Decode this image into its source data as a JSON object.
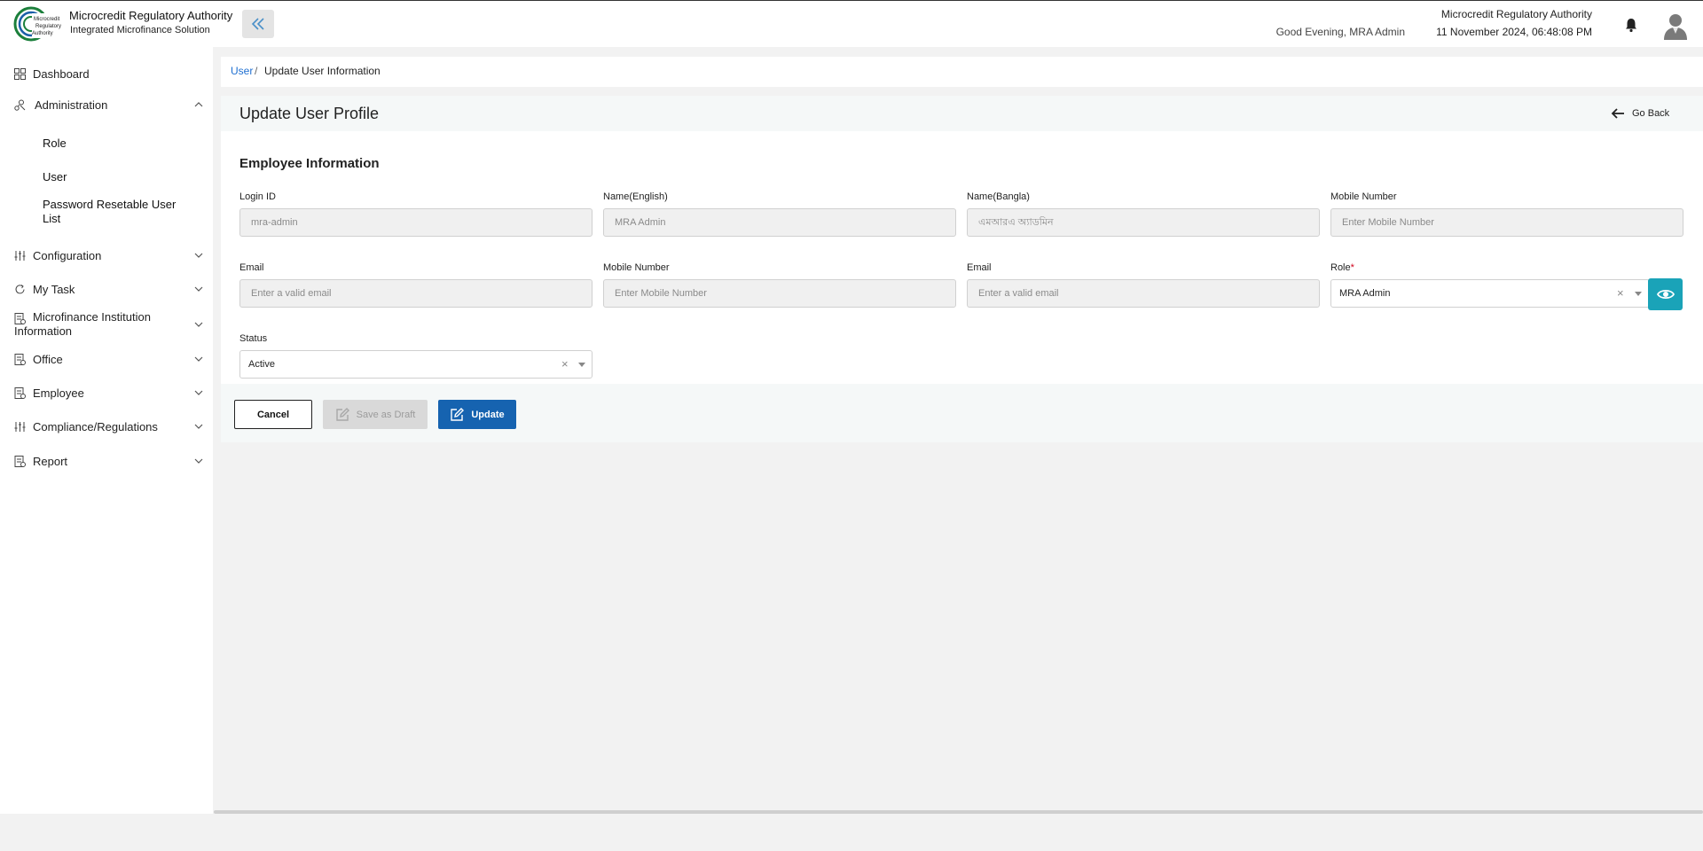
{
  "header": {
    "brand_title": "Microcredit Regulatory Authority",
    "brand_subtitle": "Integrated Microfinance Solution",
    "logo_text": "Microcredit Regulatory Authority",
    "greeting": "Good Evening, MRA Admin",
    "org_name": "Microcredit Regulatory Authority",
    "datetime": "11 November 2024, 06:48:08 PM"
  },
  "colors": {
    "primary": "#1663b0",
    "accent_teal": "#1aa3b8",
    "link": "#1e6fd1",
    "required": "#d0021b"
  },
  "sidebar": {
    "items": [
      {
        "label": "Dashboard",
        "icon": "grid-icon"
      },
      {
        "label": "Administration",
        "icon": "admin-icon",
        "expanded": true
      },
      {
        "label": "Configuration",
        "icon": "sliders-icon"
      },
      {
        "label": "My Task",
        "icon": "refresh-icon"
      },
      {
        "label": "Microfinance Institution Information",
        "icon": "document-icon"
      },
      {
        "label": "Office",
        "icon": "document-icon"
      },
      {
        "label": "Employee",
        "icon": "document-icon"
      },
      {
        "label": "Compliance/Regulations",
        "icon": "sliders-icon"
      },
      {
        "label": "Report",
        "icon": "document-icon"
      }
    ],
    "sub_items": [
      "Role",
      "User",
      "Password Resetable User List"
    ]
  },
  "breadcrumb": {
    "parent": "User",
    "separator": "/",
    "current": "Update User Information"
  },
  "page": {
    "title": "Update User Profile",
    "go_back": "Go Back",
    "section_title": "Employee Information"
  },
  "form": {
    "login_id": {
      "label": "Login ID",
      "placeholder": "mra-admin"
    },
    "name_en": {
      "label": "Name(English)",
      "placeholder": "MRA Admin"
    },
    "name_bn": {
      "label": "Name(Bangla)",
      "placeholder": "এমআরএ অ্যাডমিন"
    },
    "mobile1": {
      "label": "Mobile Number",
      "placeholder": "Enter Mobile Number"
    },
    "email1": {
      "label": "Email",
      "placeholder": "Enter a valid email"
    },
    "mobile2": {
      "label": "Mobile Number",
      "placeholder": "Enter Mobile Number"
    },
    "email2": {
      "label": "Email",
      "placeholder": "Enter a valid email"
    },
    "role": {
      "label": "Role",
      "required_mark": "*",
      "value": "MRA Admin",
      "clear": "×"
    },
    "status": {
      "label": "Status",
      "value": "Active",
      "clear": "×"
    }
  },
  "actions": {
    "cancel": "Cancel",
    "save_draft": "Save as Draft",
    "update": "Update"
  }
}
